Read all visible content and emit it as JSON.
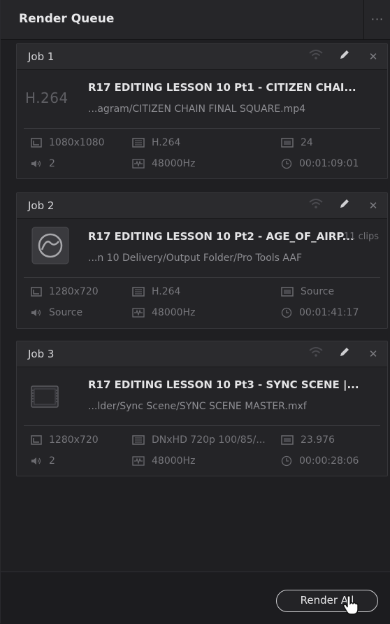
{
  "panel": {
    "title": "Render Queue",
    "more_icon": "ellipsis-icon"
  },
  "jobs": [
    {
      "name": "Job 1",
      "title": "R17 EDITING LESSON 10 Pt1 - CITIZEN CHAI...",
      "path": "...agram/CITIZEN CHAIN FINAL SQUARE.mp4",
      "thumb_text": "H.264",
      "thumb_icon": "codec-text",
      "clips": "",
      "resolution": "1080x1080",
      "codec": "H.264",
      "fps": "24",
      "audio": "2",
      "sample_rate": "48000Hz",
      "duration": "00:01:09:01"
    },
    {
      "name": "Job 2",
      "title": "R17 EDITING LESSON 10 Pt2 - AGE_OF_AIRP...",
      "path": "...n 10 Delivery/Output Folder/Pro Tools AAF",
      "thumb_text": "",
      "thumb_icon": "pro-tools-icon",
      "clips": "11 clips",
      "resolution": "1280x720",
      "codec": "H.264",
      "fps": "Source",
      "audio": "Source",
      "sample_rate": "48000Hz",
      "duration": "00:01:41:17"
    },
    {
      "name": "Job 3",
      "title": "R17 EDITING LESSON 10 Pt3 - SYNC SCENE |...",
      "path": "...lder/Sync Scene/SYNC SCENE MASTER.mxf",
      "thumb_text": "",
      "thumb_icon": "film-frame-icon",
      "clips": "",
      "resolution": "1280x720",
      "codec": "DNxHD 720p 100/85/...",
      "fps": "23.976",
      "audio": "2",
      "sample_rate": "48000Hz",
      "duration": "00:00:28:06"
    }
  ],
  "footer": {
    "render_all_label": "Render All"
  }
}
